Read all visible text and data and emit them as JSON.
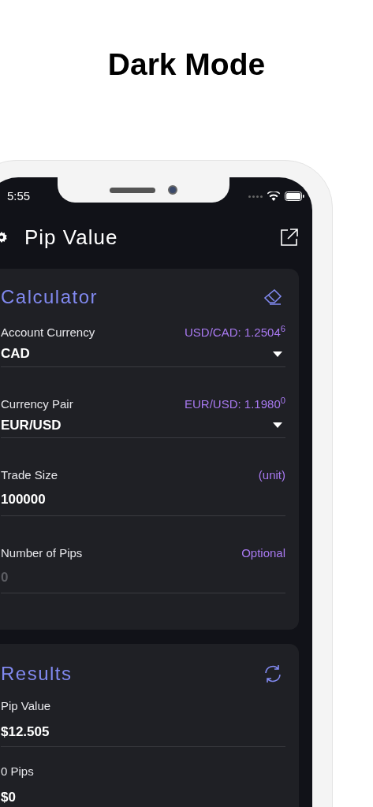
{
  "page_title": "Dark Mode",
  "status_bar": {
    "time": "5:55"
  },
  "header": {
    "title": "Pip Value"
  },
  "calculator": {
    "title": "Calculator",
    "fields": [
      {
        "kind": "select",
        "label": "Account Currency",
        "hint": "USD/CAD: 1.2504$^{6}$",
        "value": "CAD"
      },
      {
        "kind": "select",
        "label": "Currency Pair",
        "hint": "EUR/USD: 1.1980$^{0}$",
        "value": "EUR/USD"
      },
      {
        "kind": "input",
        "label": "Trade Size",
        "hint": "(unit)",
        "value": "100000"
      },
      {
        "kind": "input",
        "label": "Number of Pips",
        "hint": "Optional",
        "placeholder": "0"
      }
    ]
  },
  "results": {
    "title": "Results",
    "items": [
      {
        "label": "Pip Value",
        "value": "$12.505"
      },
      {
        "label": "0 Pips",
        "value": "$0"
      }
    ]
  }
}
